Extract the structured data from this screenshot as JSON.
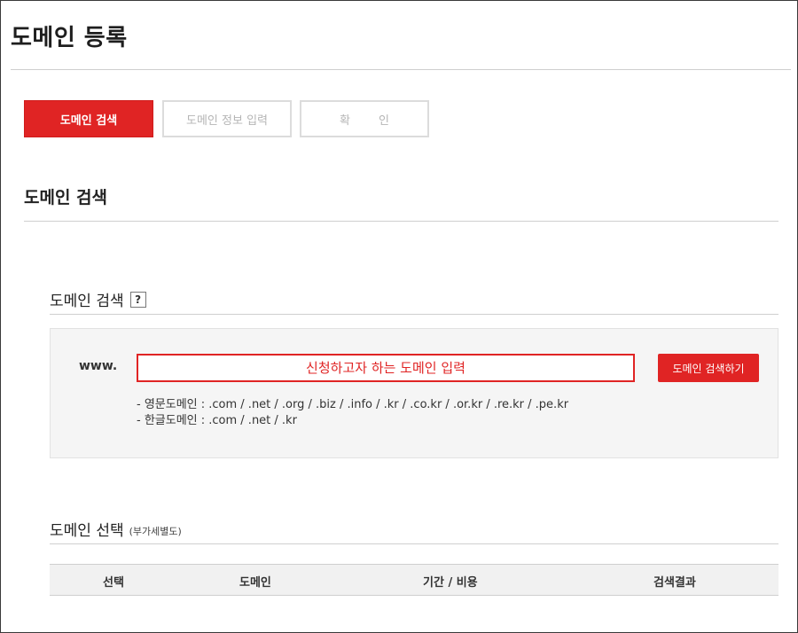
{
  "page": {
    "title": "도메인 등록"
  },
  "steps": [
    {
      "label": "도메인 검색",
      "active": true
    },
    {
      "label": "도메인 정보 입력",
      "active": false
    },
    {
      "label": "확 인",
      "active": false
    }
  ],
  "section": {
    "title": "도메인 검색"
  },
  "search": {
    "title": "도메인 검색",
    "help_icon": "?",
    "prefix": "www.",
    "input_placeholder": "신청하고자 하는 도메인 입력",
    "button_label": "도메인 검색하기",
    "extensions": [
      "- 영문도메인 : .com / .net / .org / .biz / .info / .kr / .co.kr / .or.kr / .re.kr / .pe.kr",
      "- 한글도메인 : .com / .net / .kr"
    ]
  },
  "selection": {
    "title": "도메인 선택",
    "note": "(부가세별도)",
    "columns": [
      "선택",
      "도메인",
      "기간 / 비용",
      "검색결과"
    ]
  },
  "colors": {
    "accent": "#e02424",
    "panel_bg": "#f5f5f5"
  }
}
